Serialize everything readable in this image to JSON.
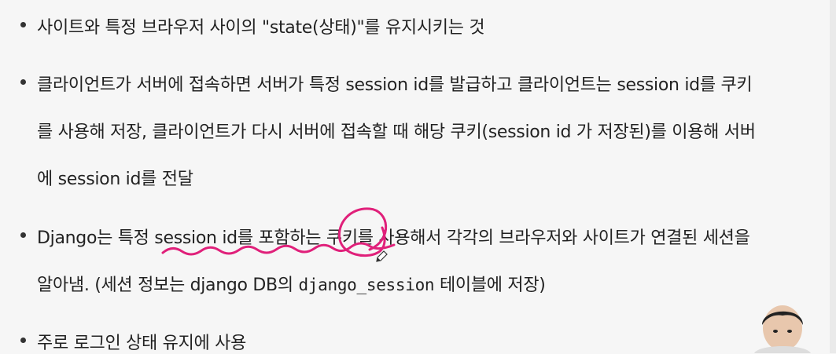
{
  "bullets": [
    {
      "lines": [
        "사이트와 특정 브라우저 사이의 \"state(상태)\"를 유지시키는 것"
      ]
    },
    {
      "lines": [
        "클라이언트가 서버에 접속하면 서버가 특정 session id를 발급하고 클라이언트는 session id를 쿠키",
        "를 사용해 저장, 클라이언트가 다시 서버에 접속할 때 해당 쿠키(session id 가 저장된)를 이용해 서버",
        "에 session id를 전달"
      ]
    },
    {
      "line1": "Django는 특정 session id를 포함하는 쿠키를 사용해서 각각의 브라우저와 사이트가 연결된 세션을",
      "line2_a": "알아냄. (세션 정보는 django DB의 ",
      "line2_code": "django_session",
      "line2_b": " 테이블에 저장)"
    },
    {
      "lines": [
        "주로 로그인 상태 유지에 사용"
      ]
    }
  ],
  "colors": {
    "annotation": "#e0207a",
    "background": "#f6f6f6",
    "text": "#222222"
  },
  "icons": {
    "cursor": "pen-cursor-icon",
    "presenter": "presenter-avatar"
  }
}
